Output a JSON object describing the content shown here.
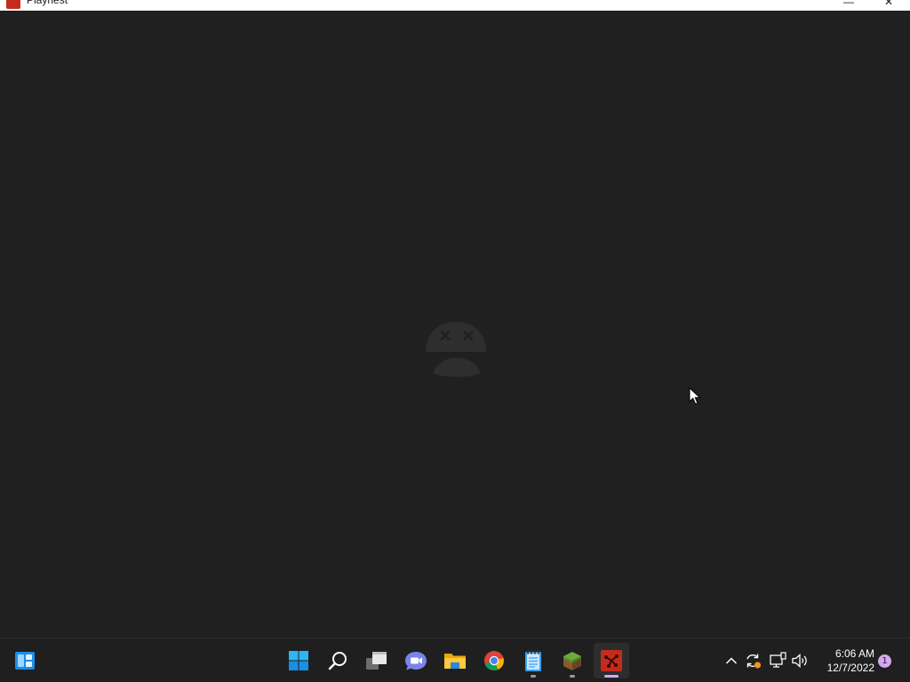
{
  "window": {
    "title": "Playnest",
    "minimize_glyph": "—",
    "close_glyph": "✕",
    "accent_color": "#c42b1c"
  },
  "app_body": {
    "background_color": "#202020",
    "state_icon": "sad-face-icon"
  },
  "taskbar": {
    "background_color": "#1f1f1f",
    "widgets_icon": "widgets-icon",
    "pinned": [
      {
        "name": "start",
        "icon": "windows-logo-icon",
        "running": false,
        "active": false
      },
      {
        "name": "search",
        "icon": "search-icon",
        "running": false,
        "active": false
      },
      {
        "name": "task-view",
        "icon": "task-view-icon",
        "running": false,
        "active": false
      },
      {
        "name": "teams-chat",
        "icon": "video-chat-icon",
        "running": false,
        "active": false
      },
      {
        "name": "file-explorer",
        "icon": "folder-icon",
        "running": false,
        "active": false
      },
      {
        "name": "chrome",
        "icon": "chrome-icon",
        "running": false,
        "active": false
      },
      {
        "name": "notepad",
        "icon": "notepad-icon",
        "running": true,
        "active": false
      },
      {
        "name": "minecraft",
        "icon": "grass-block-icon",
        "running": true,
        "active": false
      },
      {
        "name": "playnest",
        "icon": "playnest-icon",
        "running": true,
        "active": true
      }
    ],
    "tray": {
      "icons": [
        "chevron-up-icon",
        "sync-icon",
        "network-icon",
        "volume-icon"
      ],
      "time": "6:06 AM",
      "date": "12/7/2022",
      "notification_count": "1"
    }
  }
}
